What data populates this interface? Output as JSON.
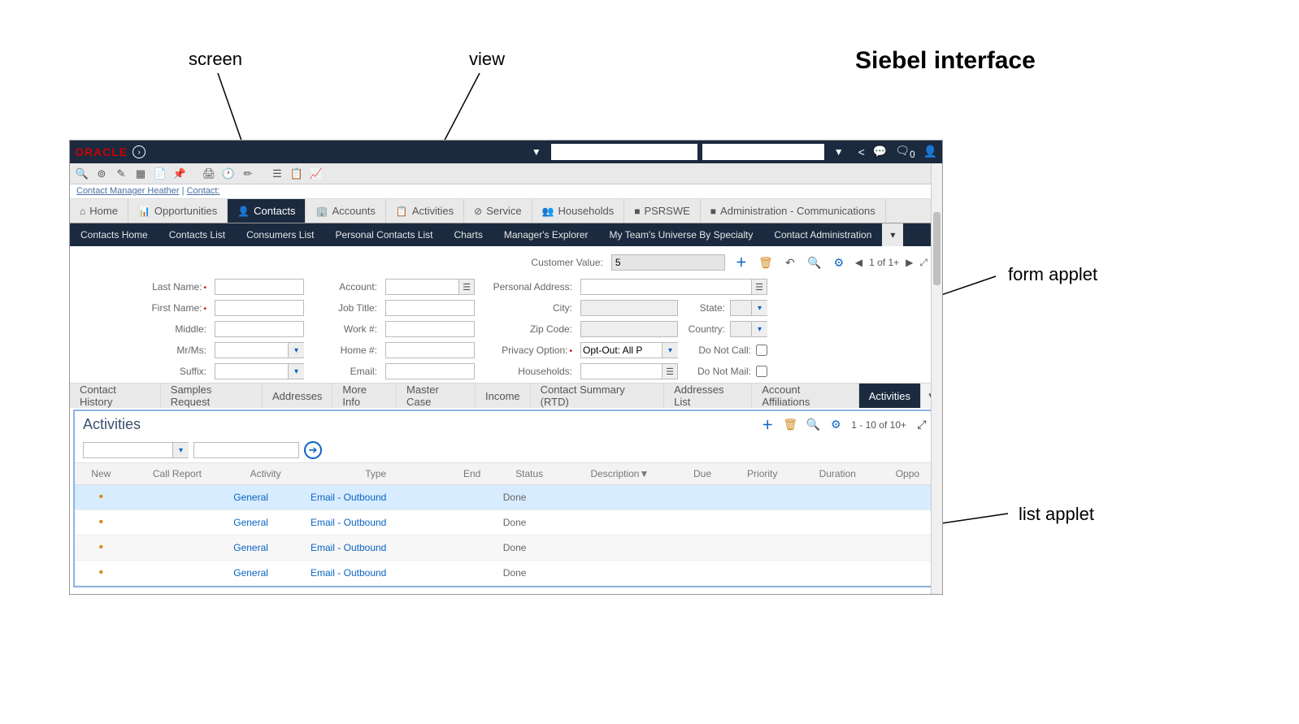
{
  "annotations": {
    "screen": "screen",
    "view": "view",
    "form_applet": "form applet",
    "list_applet": "list applet",
    "title": "Siebel interface"
  },
  "topbar": {
    "logo": "ORACLE",
    "notif_count": "0"
  },
  "breadcrumb": {
    "a": "Contact Manager Heather",
    "b": "Contact:"
  },
  "screen_tabs": [
    {
      "icon": "⌂",
      "label": "Home"
    },
    {
      "icon": "📊",
      "label": "Opportunities"
    },
    {
      "icon": "👤",
      "label": "Contacts",
      "active": true
    },
    {
      "icon": "🏢",
      "label": "Accounts"
    },
    {
      "icon": "📋",
      "label": "Activities"
    },
    {
      "icon": "⊘",
      "label": "Service"
    },
    {
      "icon": "👥",
      "label": "Households"
    },
    {
      "icon": "■",
      "label": "PSRSWE"
    },
    {
      "icon": "■",
      "label": "Administration - Communications"
    }
  ],
  "view_tabs": [
    "Contacts Home",
    "Contacts List",
    "Consumers List",
    "Personal Contacts List",
    "Charts",
    "Manager's Explorer",
    "My Team's Universe By Specialty",
    "Contact Administration"
  ],
  "form": {
    "cv_label": "Customer Value:",
    "cv_value": "5",
    "pager": "1 of 1+",
    "labels": {
      "last_name": "Last Name:",
      "first_name": "First Name:",
      "middle": "Middle:",
      "mrms": "Mr/Ms:",
      "suffix": "Suffix:",
      "account": "Account:",
      "job_title": "Job Title:",
      "work": "Work #:",
      "home": "Home #:",
      "email": "Email:",
      "personal_address": "Personal Address:",
      "city": "City:",
      "zip": "Zip Code:",
      "privacy": "Privacy Option:",
      "households": "Households:",
      "state": "State:",
      "country": "Country:",
      "do_not_call": "Do Not Call:",
      "do_not_mail": "Do Not Mail:"
    },
    "values": {
      "privacy": "Opt-Out: All P"
    }
  },
  "detail_tabs": [
    "Contact History",
    "Samples Request",
    "Addresses",
    "More Info",
    "Master Case",
    "Income",
    "Contact Summary (RTD)",
    "Addresses List",
    "Account Affiliations",
    "Activities"
  ],
  "detail_active": "Activities",
  "list": {
    "title": "Activities",
    "pager": "1 - 10 of 10+",
    "columns": [
      "New",
      "Call Report",
      "Activity",
      "Type",
      "End",
      "Status",
      "Description▼",
      "Due",
      "Priority",
      "Duration",
      "Oppo"
    ],
    "rows": [
      {
        "activity": "General",
        "type": "Email - Outbound",
        "status": "Done",
        "selected": true
      },
      {
        "activity": "General",
        "type": "Email - Outbound",
        "status": "Done"
      },
      {
        "activity": "General",
        "type": "Email - Outbound",
        "status": "Done",
        "alt": true
      },
      {
        "activity": "General",
        "type": "Email - Outbound",
        "status": "Done"
      }
    ]
  }
}
